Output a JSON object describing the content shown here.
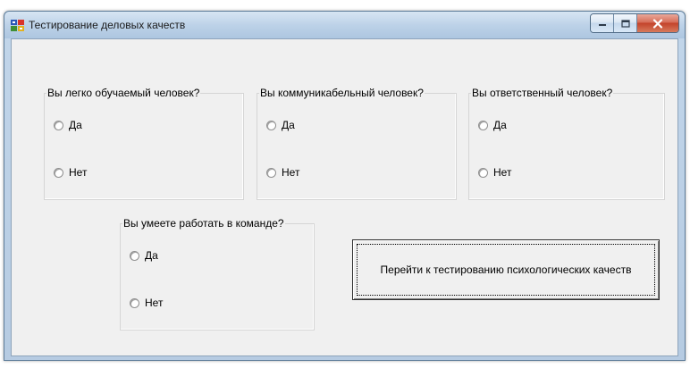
{
  "window": {
    "title": "Тестирование деловых качеств",
    "caption": {
      "minimize": "minimize-icon",
      "maximize": "maximize-icon",
      "close": "close-icon"
    },
    "accent_close": "#c3432a"
  },
  "groups": [
    {
      "title": "Вы легко обучаемый человек?",
      "options": [
        "Да",
        "Нет"
      ]
    },
    {
      "title": "Вы коммуникабельный человек?",
      "options": [
        "Да",
        "Нет"
      ]
    },
    {
      "title": "Вы ответственный человек?",
      "options": [
        "Да",
        "Нет"
      ]
    },
    {
      "title": "Вы умеете работать в команде?",
      "options": [
        "Да",
        "Нет"
      ]
    }
  ],
  "next_button": {
    "label": "Перейти к тестированию психологических качеств"
  }
}
